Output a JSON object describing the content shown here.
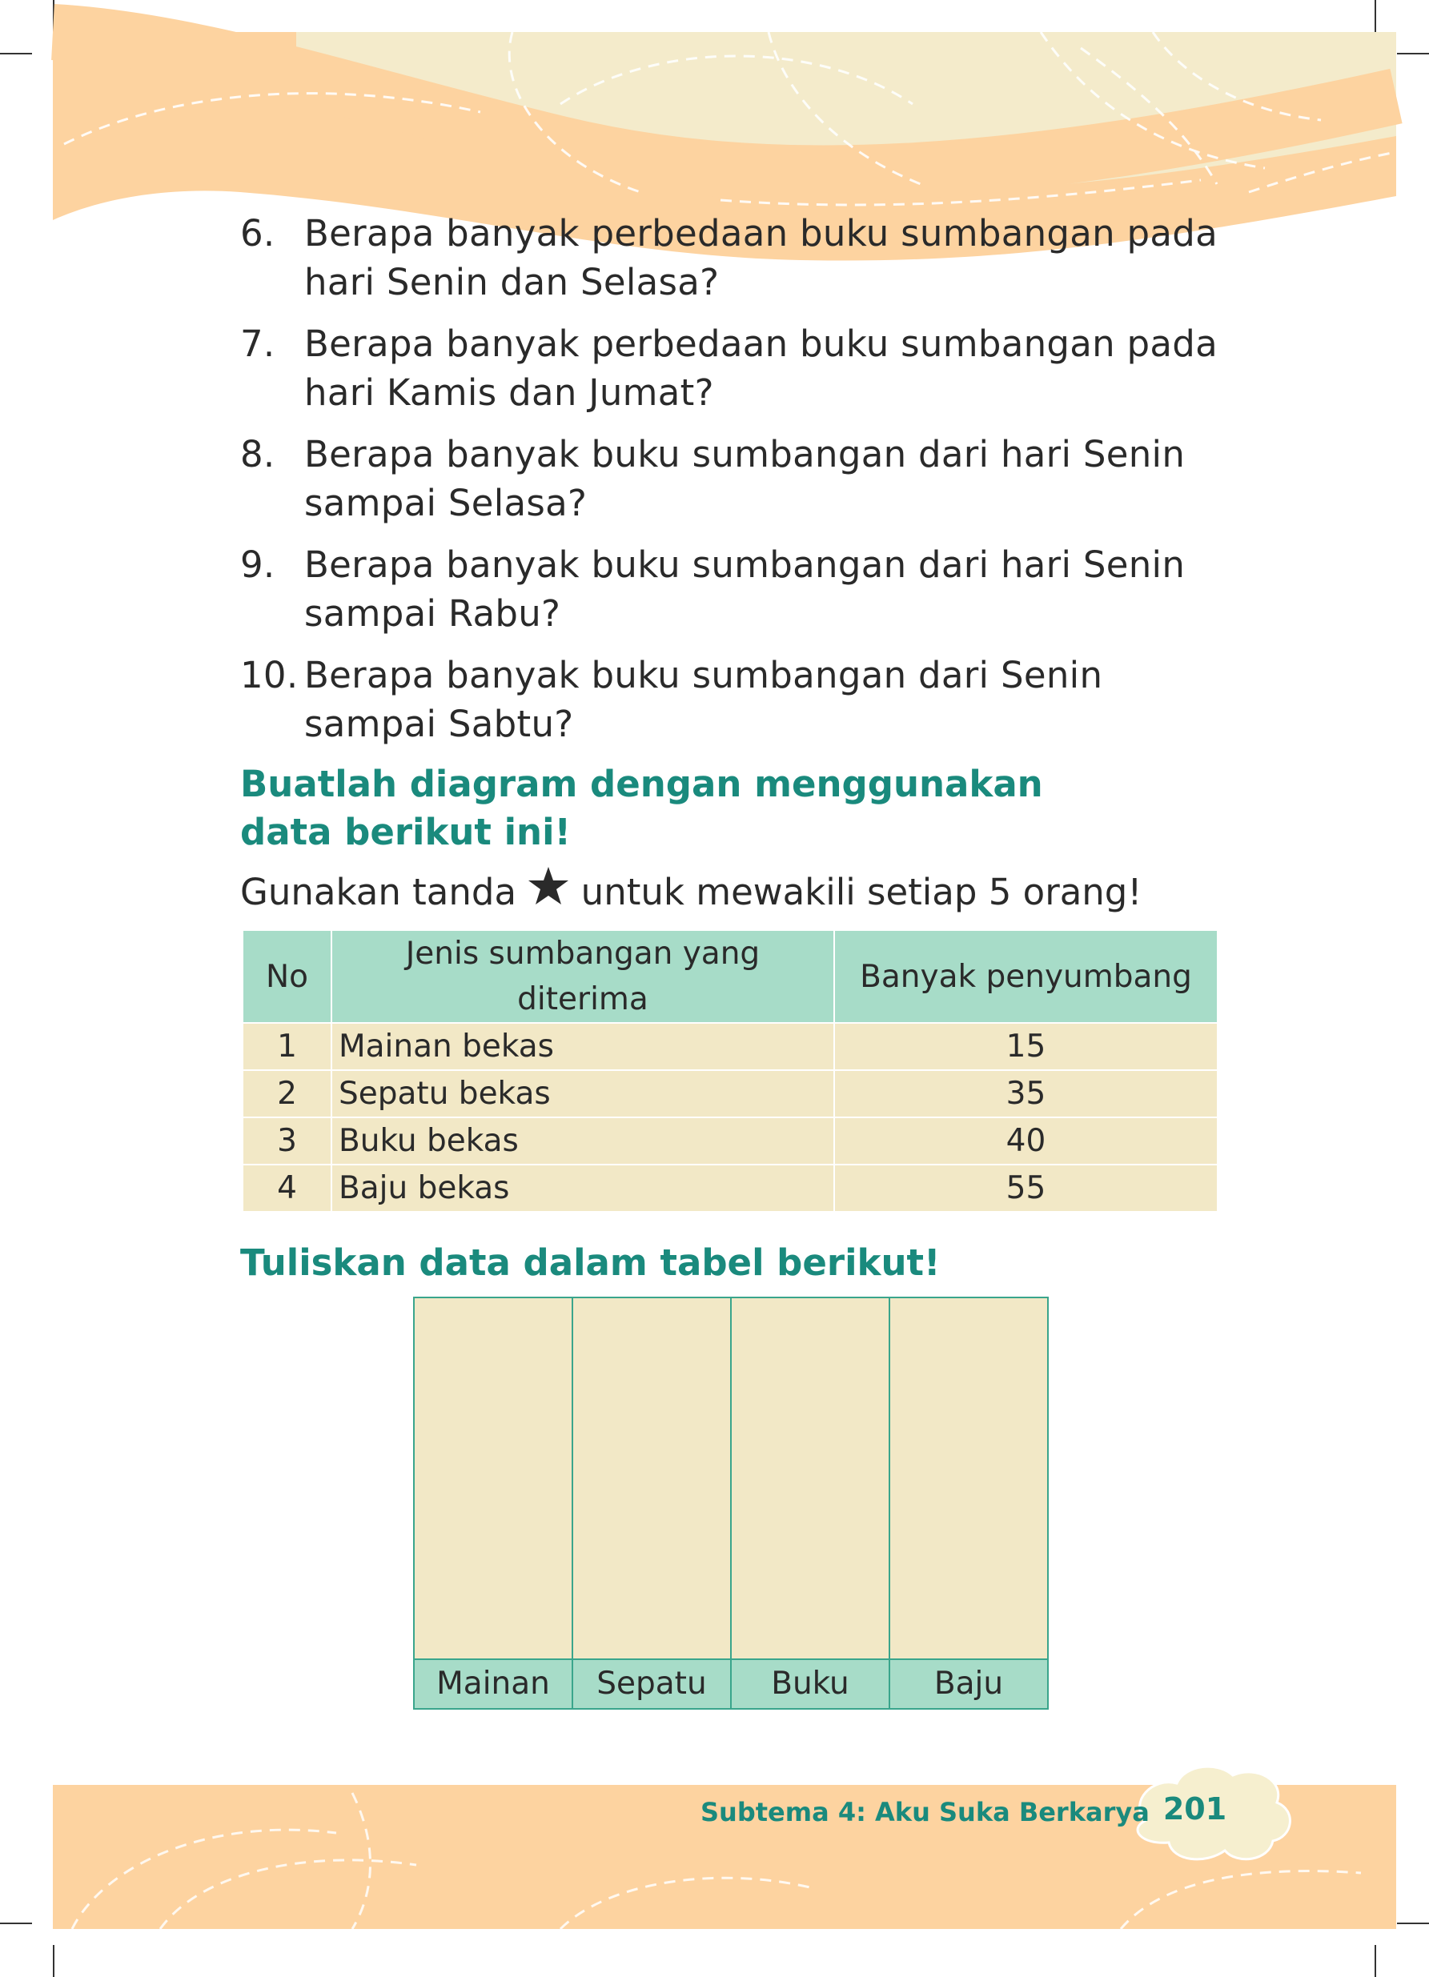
{
  "questions": [
    {
      "num": "6.",
      "text": "Berapa banyak perbedaan buku sumbangan pada hari Senin dan Selasa?"
    },
    {
      "num": "7.",
      "text": "Berapa banyak perbedaan buku sumbangan pada hari Kamis dan Jumat?"
    },
    {
      "num": "8.",
      "text": "Berapa banyak buku sumbangan dari hari Senin sampai Selasa?"
    },
    {
      "num": "9.",
      "text": "Berapa banyak buku sumbangan dari hari Senin sampai Rabu?"
    },
    {
      "num": "10.",
      "text": "Berapa banyak buku sumbangan dari Senin sampai Sabtu?"
    }
  ],
  "section1": {
    "heading": "Buatlah diagram dengan menggunakan data berikut ini!",
    "instruction_before": "Gunakan tanda",
    "instruction_icon": "star-icon",
    "instruction_after": "untuk mewakili setiap 5 orang!"
  },
  "table": {
    "headers": [
      "No",
      "Jenis sumbangan yang diterima",
      "Banyak penyumbang"
    ],
    "rows": [
      [
        "1",
        "Mainan bekas",
        "15"
      ],
      [
        "2",
        "Sepatu bekas",
        "35"
      ],
      [
        "3",
        "Buku bekas",
        "40"
      ],
      [
        "4",
        "Baju bekas",
        "55"
      ]
    ]
  },
  "section2": {
    "heading": "Tuliskan data dalam tabel berikut!",
    "columns": [
      "Mainan",
      "Sepatu",
      "Buku",
      "Baju"
    ]
  },
  "footer": {
    "subtheme": "Subtema 4: Aku Suka Berkarya",
    "page_number": "201"
  },
  "colors": {
    "accent_teal": "#1a8a7d",
    "table_header": "#a7dcc8",
    "table_body": "#f2e8c6",
    "banner_orange": "#fdd3a0",
    "banner_cream": "#f4ebcb"
  }
}
